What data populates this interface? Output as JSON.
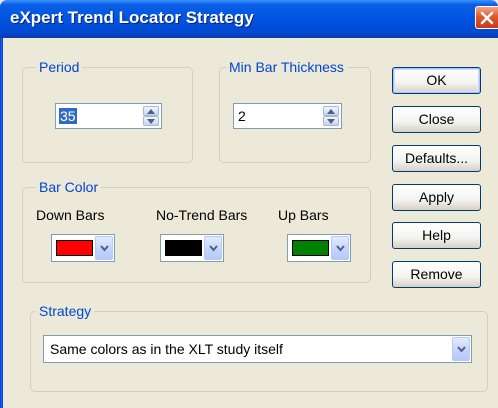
{
  "window": {
    "title": "eXpert Trend Locator Strategy"
  },
  "period": {
    "legend": "Period",
    "value": "35"
  },
  "min_bar_thickness": {
    "legend": "Min Bar Thickness",
    "value": "2"
  },
  "bar_color": {
    "legend": "Bar Color",
    "down": {
      "label": "Down Bars",
      "color": "#ff0000"
    },
    "no_trend": {
      "label": "No-Trend Bars",
      "color": "#000000"
    },
    "up": {
      "label": "Up Bars",
      "color": "#008000"
    }
  },
  "strategy": {
    "legend": "Strategy",
    "selected": "Same colors as in the XLT study itself"
  },
  "buttons": {
    "ok": "OK",
    "close": "Close",
    "defaults": "Defaults...",
    "apply": "Apply",
    "help": "Help",
    "remove": "Remove"
  },
  "icons": {
    "window_close": "close-x-icon",
    "spin_up": "triangle-up-icon",
    "spin_down": "triangle-down-icon",
    "dropdown": "chevron-down-icon"
  }
}
